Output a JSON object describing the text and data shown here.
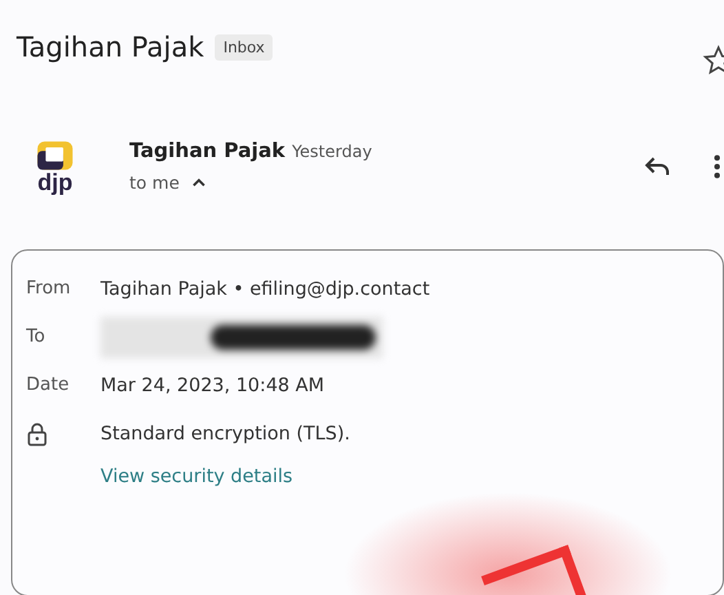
{
  "subject": {
    "title": "Tagihan Pajak",
    "label": "Inbox"
  },
  "sender": {
    "logo_text": "djp",
    "name": "Tagihan Pajak",
    "time": "Yesterday",
    "recipient": "to me",
    "details_expanded": true
  },
  "details": [
    {
      "kind": "field",
      "label": "From",
      "value": "Tagihan Pajak • efiling@djp.contact"
    },
    {
      "kind": "redacted",
      "label": "To"
    },
    {
      "kind": "field",
      "label": "Date",
      "value": "Mar 24, 2023, 10:48 AM"
    },
    {
      "kind": "security",
      "value": "Standard encryption (TLS).",
      "link": "View security details"
    }
  ]
}
